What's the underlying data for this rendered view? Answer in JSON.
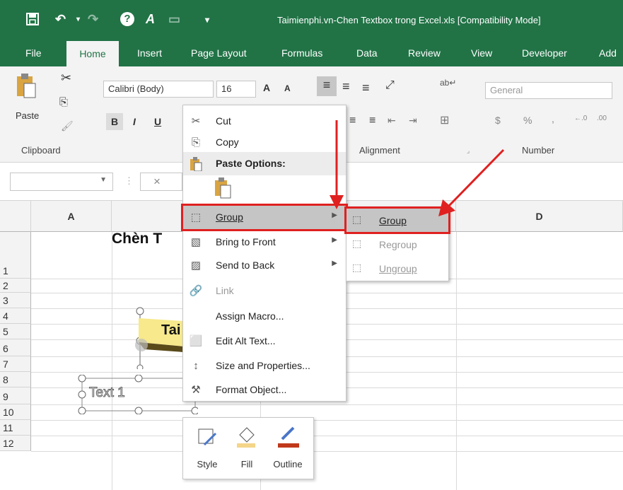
{
  "window": {
    "title": "Taimienphi.vn-Chen Textbox trong Excel.xls  [Compatibility Mode]"
  },
  "quick_access": {
    "save": "🖐",
    "undo": "↶",
    "redo": "↷",
    "help": "?",
    "more": "▾"
  },
  "tabs": [
    "File",
    "Home",
    "Insert",
    "Page Layout",
    "Formulas",
    "Data",
    "Review",
    "View",
    "Developer",
    "Add"
  ],
  "clipboard": {
    "paste_label": "Paste",
    "group_label": "Clipboard"
  },
  "font": {
    "name": "Calibri (Body)",
    "size": "16",
    "grow": "A",
    "shrink": "A",
    "bold": "B",
    "italic": "I",
    "underline": "U"
  },
  "alignment": {
    "group_label": "Alignment"
  },
  "number": {
    "format": "General",
    "group_label": "Number",
    "currency": "$",
    "percent": "%",
    "comma": ","
  },
  "formula_bar": {
    "cancel": "×"
  },
  "sheet": {
    "columns": [
      "A",
      "D"
    ],
    "rows": [
      "1",
      "2",
      "3",
      "4",
      "5",
      "6",
      "7",
      "8",
      "9",
      "10",
      "11",
      "12"
    ],
    "heading": "Chèn T",
    "shape_text": "Tai",
    "textbox_text": "Text 1"
  },
  "context_menu": {
    "items": [
      {
        "label": "Cut",
        "icon": "✂",
        "icon_name": "scissors-icon"
      },
      {
        "label": "Copy",
        "icon": "⎘",
        "icon_name": "copy-icon"
      },
      {
        "label": "Paste Options:",
        "icon": "📋",
        "icon_name": "paste-icon"
      },
      {
        "label": "Group",
        "icon": "⬚",
        "icon_name": "group-icon",
        "submenu": true,
        "highlighted": true
      },
      {
        "label": "Bring to Front",
        "icon": "▧",
        "icon_name": "bring-front-icon",
        "submenu": true
      },
      {
        "label": "Send to Back",
        "icon": "▨",
        "icon_name": "send-back-icon",
        "submenu": true
      },
      {
        "label": "Link",
        "icon": "🔗",
        "icon_name": "link-icon",
        "disabled": true
      },
      {
        "label": "Assign Macro...",
        "icon": "",
        "icon_name": "none"
      },
      {
        "label": "Edit Alt Text...",
        "icon": "⬜",
        "icon_name": "alt-text-icon"
      },
      {
        "label": "Size and Properties...",
        "icon": "↕",
        "icon_name": "size-icon"
      },
      {
        "label": "Format Object...",
        "icon": "⚒",
        "icon_name": "format-icon"
      }
    ]
  },
  "submenu": {
    "items": [
      {
        "label": "Group",
        "highlighted": true
      },
      {
        "label": "Regroup",
        "disabled": true
      },
      {
        "label": "Ungroup",
        "disabled": true
      }
    ]
  },
  "mini_toolbar": {
    "style": "Style",
    "fill": "Fill",
    "outline": "Outline"
  },
  "colors": {
    "excel_green": "#217346",
    "highlight_red": "#e02020",
    "menu_highlight": "#c5c5c5",
    "outline_color": "#c0391b",
    "fill_color": "#f4d58a"
  }
}
